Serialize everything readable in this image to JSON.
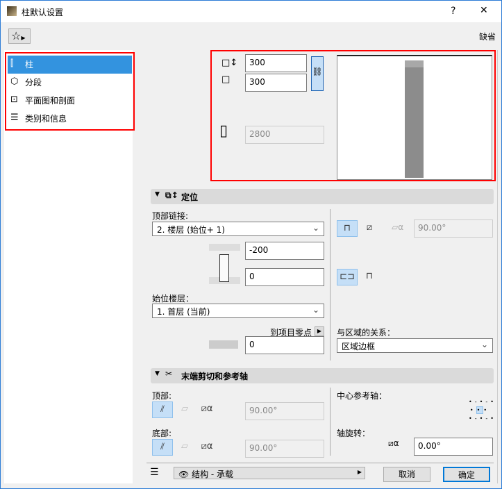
{
  "window": {
    "title": "柱默认设置",
    "help": "?",
    "close": "✕"
  },
  "toolbar": {
    "favorites": "☆",
    "default_label": "缺省"
  },
  "sidebar": {
    "items": [
      {
        "label": "柱",
        "selected": true
      },
      {
        "label": "分段"
      },
      {
        "label": "平面图和剖面"
      },
      {
        "label": "类别和信息"
      }
    ]
  },
  "dimensions": {
    "width": "300",
    "depth": "300",
    "height": "2800",
    "linked": true
  },
  "positioning": {
    "title": "定位",
    "top_link_label": "顶部链接:",
    "top_link_value": "2. 楼层 (始位+ 1)",
    "top_offset": "-200",
    "bottom_offset": "0",
    "home_story_label": "始位楼层：",
    "home_story_value": "1. 首层 (当前)",
    "to_project_zero_label": "到项目零点",
    "project_zero_value": "0",
    "slant_angle": "90.00°",
    "zone_relation_label": "与区域的关系：",
    "zone_relation_value": "区域边框"
  },
  "end_cuts": {
    "title": "末端剪切和参考轴",
    "top_label": "顶部:",
    "top_angle": "90.00°",
    "bottom_label": "底部:",
    "bottom_angle": "90.00°",
    "anchor_label": "中心参考轴：",
    "rotation_label": "轴旋转：",
    "rotation_value": "0.00°"
  },
  "footer": {
    "layer_value": "结构 - 承载",
    "cancel": "取消",
    "ok": "确定"
  },
  "colors": {
    "accent": "#3393df",
    "highlight": "#ff0000",
    "selected_icon": "#c5dff7"
  }
}
